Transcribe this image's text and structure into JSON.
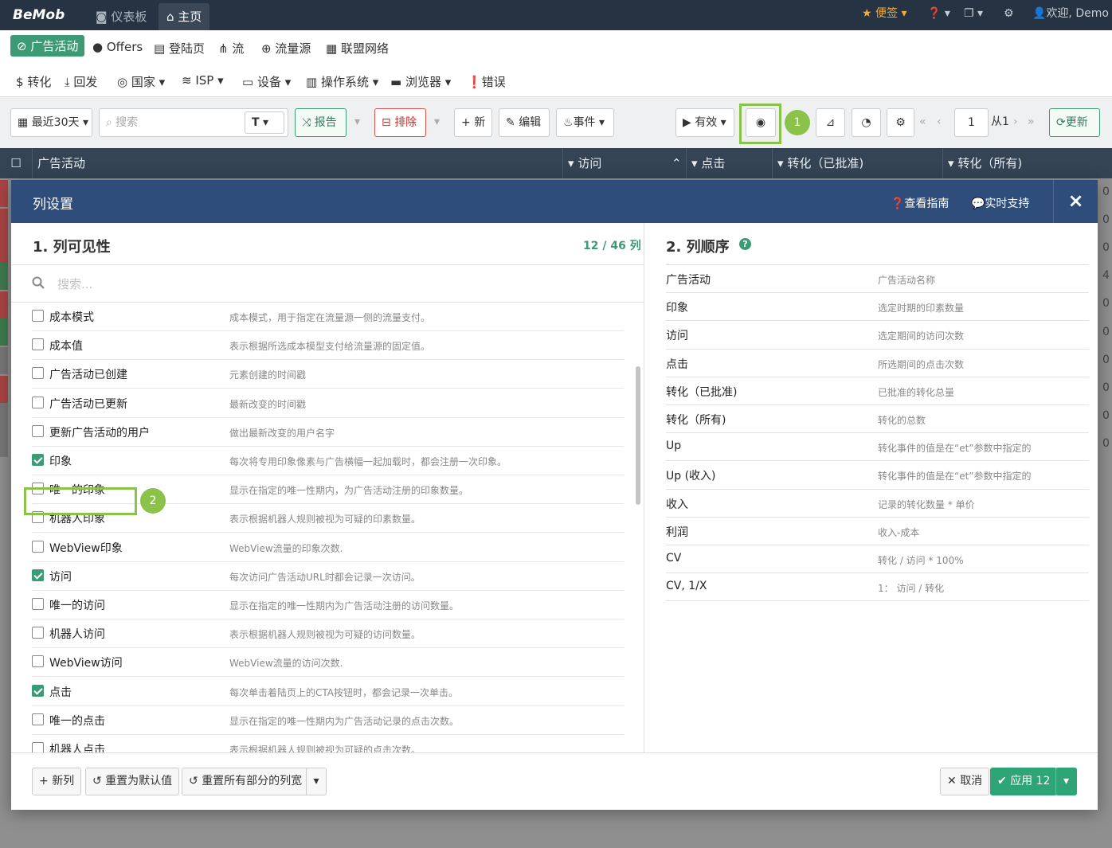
{
  "topbar": {
    "logo": "BeMob",
    "tabs": [
      {
        "label": "仪表板"
      },
      {
        "label": "主页"
      }
    ],
    "notes_label": "便签",
    "welcome": "欢迎, Demo"
  },
  "nav1": {
    "items": [
      {
        "label": "广告活动"
      },
      {
        "label": "Offers"
      },
      {
        "label": "登陆页"
      },
      {
        "label": "流"
      },
      {
        "label": "流量源"
      },
      {
        "label": "联盟网络"
      }
    ]
  },
  "nav2": {
    "items": [
      {
        "label": "转化"
      },
      {
        "label": "回发"
      },
      {
        "label": "国家"
      },
      {
        "label": "ISP"
      },
      {
        "label": "设备"
      },
      {
        "label": "操作系统"
      },
      {
        "label": "浏览器"
      },
      {
        "label": "错误"
      }
    ]
  },
  "toolbar": {
    "date_range": "最近30天",
    "search_placeholder": "搜索",
    "text_filter": "T",
    "report": "报告",
    "exclude": "排除",
    "new": "新",
    "edit": "编辑",
    "events": "事件",
    "active": "有效",
    "page_value": "1",
    "page_of": "从1",
    "refresh": "更新"
  },
  "steps": {
    "one": "1",
    "two": "2"
  },
  "table": {
    "headers": [
      "广告活动",
      "访问",
      "点击",
      "转化（已批准)",
      "转化（所有)"
    ],
    "right_values": [
      "0",
      "0",
      "0",
      "4",
      "0",
      "0",
      "0",
      "0",
      "0",
      "0"
    ]
  },
  "modal": {
    "title": "列设置",
    "guide": "查看指南",
    "support": "实时支持",
    "close": "×",
    "visibility_title": "1. 列可见性",
    "visibility_count": "12 / 46 列",
    "search_placeholder": "搜索...",
    "order_title": "2. 列顺序",
    "help": "?",
    "columns": [
      {
        "name": "成本模式",
        "desc": "成本模式，用于指定在流量源一侧的流量支付。",
        "checked": false
      },
      {
        "name": "成本值",
        "desc": "表示根据所选成本模型支付给流量源的固定值。",
        "checked": false
      },
      {
        "name": "广告活动已创建",
        "desc": "元素创建的时间戳",
        "checked": false
      },
      {
        "name": "广告活动已更新",
        "desc": "最新改变的时间戳",
        "checked": false
      },
      {
        "name": "更新广告活动的用户",
        "desc": "做出最新改变的用户名字",
        "checked": false
      },
      {
        "name": "印象",
        "desc": "每次将专用印象像素与广告横幅一起加载时，都会注册一次印象。",
        "checked": true
      },
      {
        "name": "唯一的印象",
        "desc": "显示在指定的唯一性期内，为广告活动注册的印象数量。",
        "checked": false
      },
      {
        "name": "机器人印象",
        "desc": "表示根据机器人规则被视为可疑的印素数量。",
        "checked": false
      },
      {
        "name": "WebView印象",
        "desc": "WebView流量的印象次数.",
        "checked": false
      },
      {
        "name": "访问",
        "desc": "每次访问广告活动URL时都会记录一次访问。",
        "checked": true
      },
      {
        "name": "唯一的访问",
        "desc": "显示在指定的唯一性期内为广告活动注册的访问数量。",
        "checked": false
      },
      {
        "name": "机器人访问",
        "desc": "表示根据机器人规则被视为可疑的访问数量。",
        "checked": false
      },
      {
        "name": "WebView访问",
        "desc": "WebView流量的访问次数.",
        "checked": false
      },
      {
        "name": "点击",
        "desc": "每次单击着陆页上的CTA按钮时，都会记录一次单击。",
        "checked": true
      },
      {
        "name": "唯一的点击",
        "desc": "显示在指定的唯一性期内为广告活动记录的点击次数。",
        "checked": false
      },
      {
        "name": "机器人点击",
        "desc": "表示根据机器人规则被视为可疑的点击次数。",
        "checked": false
      }
    ],
    "order": [
      {
        "name": "广告活动",
        "desc": "广告活动名称"
      },
      {
        "name": "印象",
        "desc": "选定时期的印素数量"
      },
      {
        "name": "访问",
        "desc": "选定期间的访问次数"
      },
      {
        "name": "点击",
        "desc": "所选期间的点击次数"
      },
      {
        "name": "转化（已批准)",
        "desc": "已批准的转化总量"
      },
      {
        "name": "转化（所有)",
        "desc": "转化的总数"
      },
      {
        "name": "Up",
        "desc": "转化事件的值是在“et”参数中指定的"
      },
      {
        "name": "Up (收入)",
        "desc": "转化事件的值是在“et”参数中指定的"
      },
      {
        "name": "收入",
        "desc": "记录的转化数量 * 单价"
      },
      {
        "name": "利润",
        "desc": "收入-成本"
      },
      {
        "name": "CV",
        "desc": "转化 / 访问 * 100%"
      },
      {
        "name": "CV, 1/X",
        "desc": "1： 访问 / 转化"
      }
    ],
    "footer": {
      "new_column": "新列",
      "reset_default": "重置为默认值",
      "reset_widths": "重置所有部分的列宽",
      "cancel": "取消",
      "apply": "应用 12"
    }
  },
  "colors": {
    "accent": "#3c9a74",
    "header": "#2e4d7b",
    "topbar": "#253342",
    "highlight": "#8bc34a"
  }
}
